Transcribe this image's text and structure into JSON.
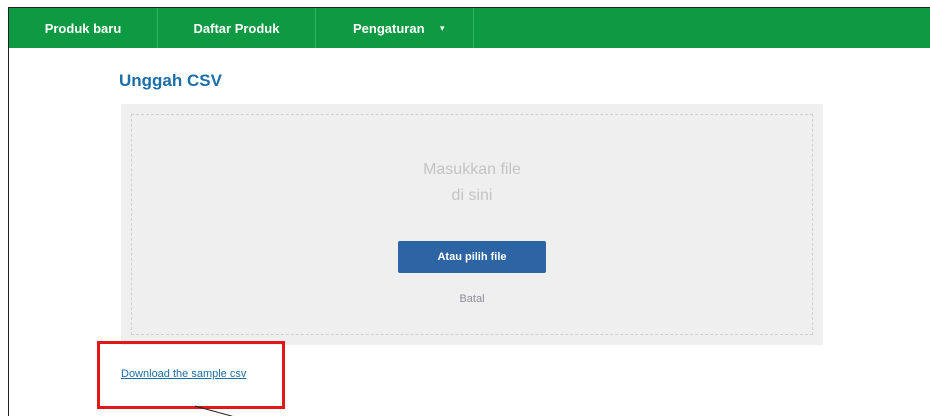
{
  "nav": {
    "items": [
      {
        "label": "Produk baru"
      },
      {
        "label": "Daftar Produk"
      },
      {
        "label": "Pengaturan",
        "caret": "▾"
      }
    ]
  },
  "page": {
    "title": "Unggah CSV"
  },
  "dropzone": {
    "line1": "Masukkan file",
    "line2": "di sini",
    "choose_button": "Atau pilih file",
    "cancel": "Batal"
  },
  "download": {
    "label": "Download the sample csv"
  },
  "colors": {
    "nav_bg": "#0e9a43",
    "title": "#1c6fa8",
    "button": "#2c64a4",
    "highlight": "#e01818"
  }
}
